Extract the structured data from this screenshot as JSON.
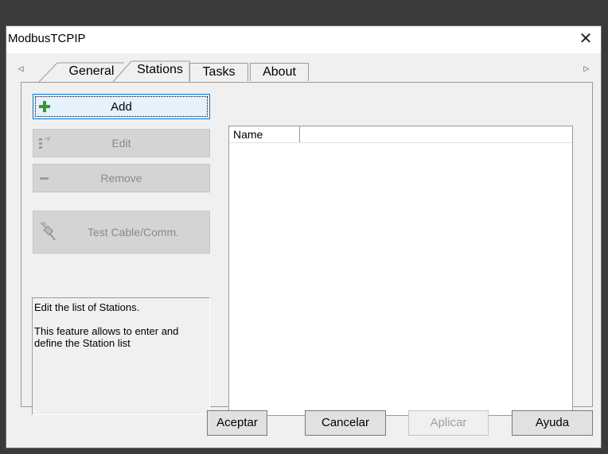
{
  "window": {
    "title": "ModbusTCPIP",
    "close_symbol": "✕"
  },
  "tabs": [
    {
      "label": "General",
      "selected": false
    },
    {
      "label": "Stations",
      "selected": true
    },
    {
      "label": "Tasks",
      "selected": false
    },
    {
      "label": "About",
      "selected": false
    }
  ],
  "scroll": {
    "left_symbol": "◁",
    "right_symbol": "▷"
  },
  "actions": {
    "add_label": "Add",
    "edit_label": "Edit",
    "remove_label": "Remove",
    "test_label": "Test Cable/Comm."
  },
  "description": {
    "line1": "Edit the list of Stations.",
    "line2": "This feature allows to enter and define the Station list"
  },
  "list": {
    "columns": [
      "Name",
      ""
    ],
    "rows": []
  },
  "footer": {
    "accept_label": "Aceptar",
    "cancel_label": "Cancelar",
    "apply_label": "Aplicar",
    "help_label": "Ayuda"
  },
  "colors": {
    "accent": "#0078d7",
    "add_icon": "#2f9e2f",
    "background": "#f0f0f0"
  }
}
